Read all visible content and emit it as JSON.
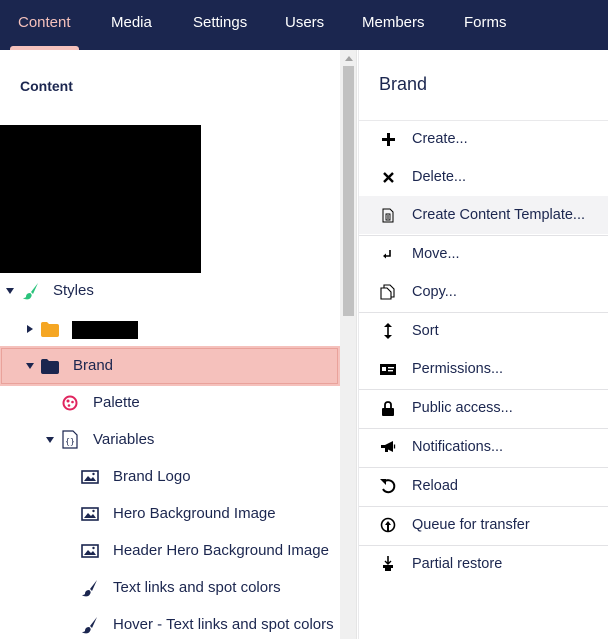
{
  "nav": {
    "items": [
      {
        "label": "Content",
        "active": true
      },
      {
        "label": "Media",
        "active": false
      },
      {
        "label": "Settings",
        "active": false
      },
      {
        "label": "Users",
        "active": false
      },
      {
        "label": "Members",
        "active": false
      },
      {
        "label": "Forms",
        "active": false
      }
    ]
  },
  "tree": {
    "header": "Content",
    "rows": [
      {
        "label": "Styles",
        "icon": "brush-icon",
        "expanded": true
      },
      {
        "label": "",
        "icon": "folder-icon",
        "expanded": false,
        "redacted": true
      },
      {
        "label": "Brand",
        "icon": "folder-icon",
        "expanded": true,
        "selected": true
      },
      {
        "label": "Palette",
        "icon": "palette-icon"
      },
      {
        "label": "Variables",
        "icon": "json-document-icon",
        "expanded": true
      },
      {
        "label": "Brand Logo",
        "icon": "image-icon"
      },
      {
        "label": "Hero Background Image",
        "icon": "image-icon"
      },
      {
        "label": "Header Hero Background Image",
        "icon": "image-icon"
      },
      {
        "label": "Text links and spot colors",
        "icon": "brush-icon"
      },
      {
        "label": "Hover - Text links and spot colors",
        "icon": "brush-icon"
      }
    ]
  },
  "menu": {
    "title": "Brand",
    "items": [
      {
        "label": "Create...",
        "icon": "plus-icon"
      },
      {
        "label": "Delete...",
        "icon": "delete-x-icon"
      },
      {
        "label": "Create Content Template...",
        "icon": "content-template-icon",
        "hover": true
      },
      {
        "label": "Move...",
        "icon": "move-icon"
      },
      {
        "label": "Copy...",
        "icon": "copy-icon"
      },
      {
        "label": "Sort",
        "icon": "sort-icon"
      },
      {
        "label": "Permissions...",
        "icon": "permissions-icon"
      },
      {
        "label": "Public access...",
        "icon": "lock-icon"
      },
      {
        "label": "Notifications...",
        "icon": "megaphone-icon"
      },
      {
        "label": "Reload",
        "icon": "reload-icon"
      },
      {
        "label": "Queue for transfer",
        "icon": "upload-icon"
      },
      {
        "label": "Partial restore",
        "icon": "restore-icon"
      }
    ]
  },
  "colors": {
    "nav_bg": "#1b264f",
    "accent": "#f5c1bc",
    "text": "#1b264f",
    "folder": "#f5a623",
    "brush_green": "#2bc37c",
    "palette_pink": "#e0245e"
  }
}
